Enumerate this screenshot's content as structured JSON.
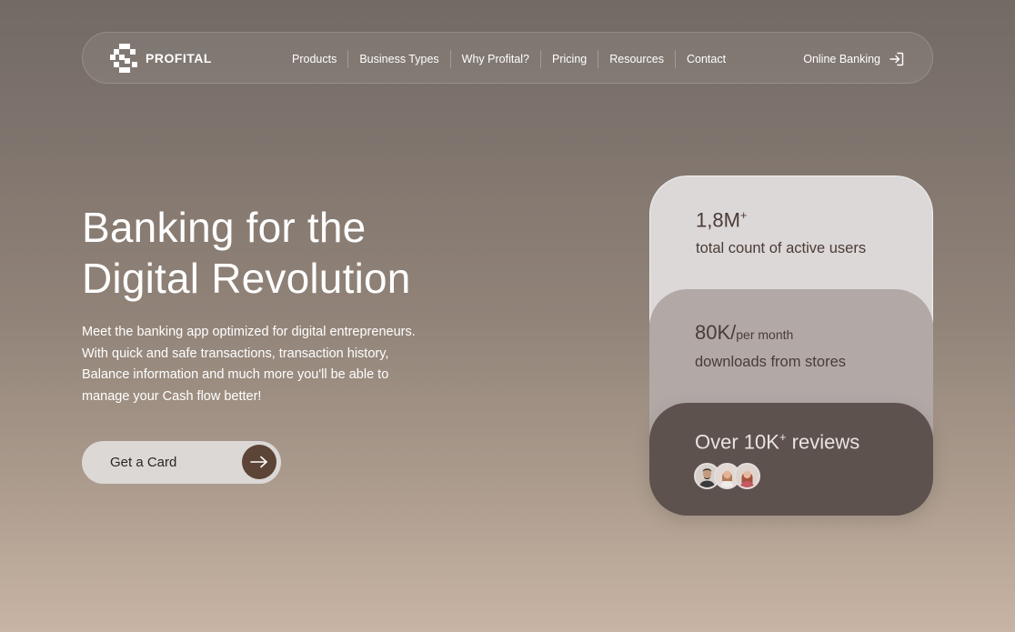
{
  "brand": {
    "name": "PROFITAL",
    "logo_icon": "pixel-s-logo-icon"
  },
  "nav": {
    "items": [
      {
        "label": "Products"
      },
      {
        "label": "Business Types"
      },
      {
        "label": "Why Profital?"
      },
      {
        "label": "Pricing"
      },
      {
        "label": "Resources"
      },
      {
        "label": "Contact"
      }
    ],
    "login_label": "Online Banking",
    "login_icon": "sign-in-icon"
  },
  "hero": {
    "title_line1": "Banking for the",
    "title_line2": "Digital Revolution",
    "description": "Meet the banking app optimized for digital entrepreneurs. With quick and safe transactions, transaction history, Balance information and much more you'll be able to manage your Cash flow better!",
    "cta_label": "Get a Card",
    "cta_icon": "arrow-right-icon"
  },
  "stats": {
    "users": {
      "value": "1,8M",
      "suffix": "+",
      "label": "total count of active users"
    },
    "downloads": {
      "value": "80K/",
      "suffix": "per month",
      "label": "downloads from stores"
    },
    "reviews": {
      "title_main": "Over 10K",
      "title_plus": "+",
      "title_rest": " reviews",
      "avatars": [
        "man-avatar",
        "woman-avatar",
        "woman-redhead-avatar"
      ]
    }
  },
  "colors": {
    "accent_dark": "#5c4436",
    "card_light": "#dcd8d8",
    "card_mid": "#b2a9a7",
    "card_dark": "#5e524e"
  }
}
